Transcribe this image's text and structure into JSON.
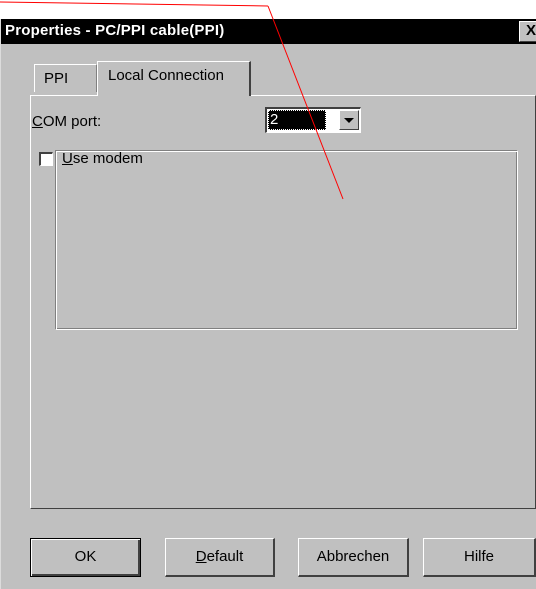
{
  "window": {
    "title": "Properties - PC/PPI cable(PPI)",
    "close_glyph": "X"
  },
  "tabs": [
    {
      "label": "PPI",
      "active": false
    },
    {
      "label": "Local Connection",
      "active": true
    }
  ],
  "local_connection": {
    "com_port": {
      "label_mnemonic": "C",
      "label_rest": "OM port:",
      "value": "2"
    },
    "use_modem": {
      "label_mnemonic": "U",
      "label_rest": "se modem",
      "checked": false
    }
  },
  "buttons": {
    "ok": "OK",
    "default_mnemonic": "D",
    "default_rest": "efault",
    "cancel": "Abbrechen",
    "help": "Hilfe"
  },
  "annotation": {
    "color": "#ff0000"
  }
}
